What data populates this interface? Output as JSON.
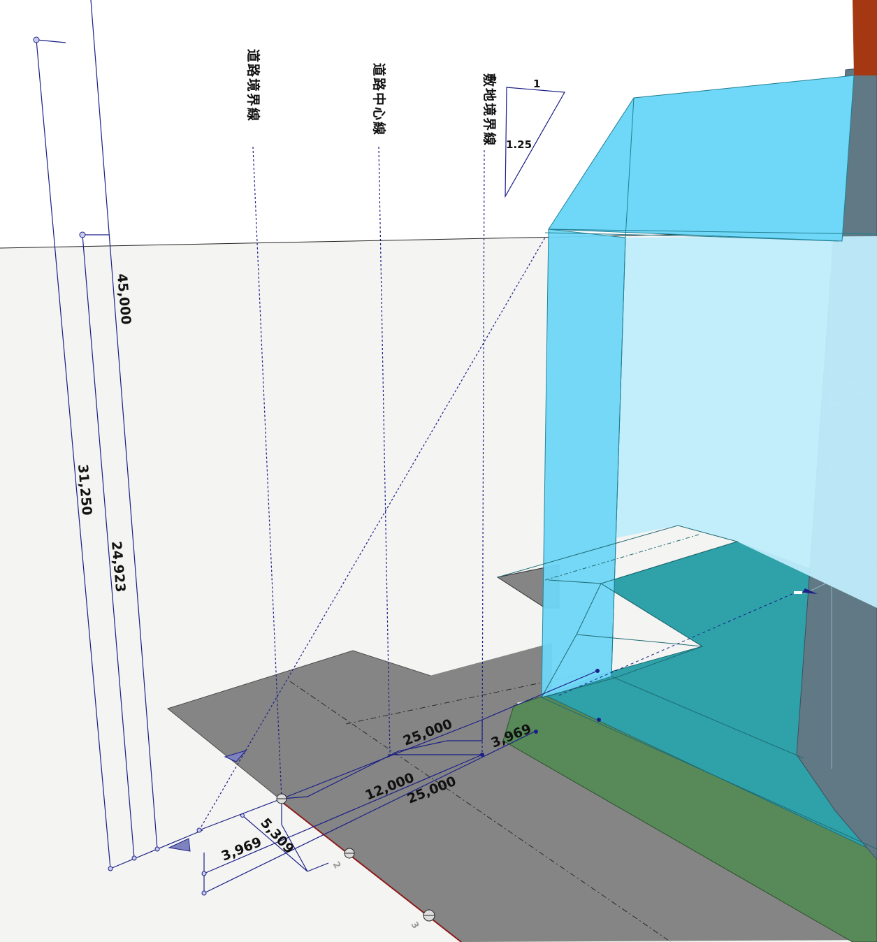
{
  "labels": {
    "road_boundary": "道路境界線",
    "road_center": "道路中心線",
    "site_boundary": "敷地境界線"
  },
  "slope_ratio": {
    "horizontal": "1",
    "vertical": "1.25"
  },
  "dimensions": {
    "total_height": "45,000",
    "height_31250": "31,250",
    "height_24923": "24,923",
    "road_25000_upper": "25,000",
    "road_25000_lower": "25,000",
    "road_12000": "12,000",
    "setback_3969_right": "3,969",
    "setback_3969_left": "3,969",
    "width_5309": "5,309"
  },
  "grid_markers": {
    "m2": "2",
    "m3": "3"
  },
  "colors": {
    "ground": "#f4f4f3",
    "road_gray": "#858585",
    "envelope_cyan": "#6fd7f7",
    "envelope_light": "#bfecfb",
    "building_teal": "#2ea1a9",
    "site_green": "#578a58",
    "neighbor_slate": "#607985",
    "roof_red": "#a33812",
    "dimension_navy": "#1b1f86"
  }
}
